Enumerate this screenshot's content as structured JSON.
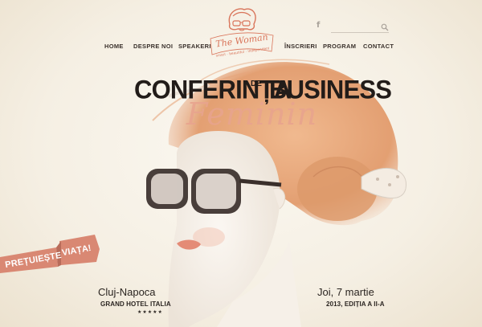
{
  "nav": {
    "left": [
      "HOME",
      "DESPRE NOI",
      "SPEAKERI"
    ],
    "right": [
      "ÎNSCRIERI",
      "PROGRAM",
      "CONTACT"
    ]
  },
  "logo": {
    "script": "The Woman",
    "tagline": "smart · beautiful · independent"
  },
  "social": {
    "facebook_glyph": "f"
  },
  "headline": {
    "line1": "CONFERINȚA",
    "small": "DE",
    "line1b": "BUSINESS",
    "line2": "Feminin"
  },
  "ribbon": {
    "part1": "PREȚUIEȘTE",
    "part2": "VIAȚA!"
  },
  "location": {
    "city": "Cluj-Napoca",
    "venue": "GRAND HOTEL ITALIA",
    "stars": "★★★★★"
  },
  "event": {
    "date": "Joi, 7 martie",
    "edition": "2013,  EDIȚIA  A II-A"
  },
  "colors": {
    "accent": "#d9745a",
    "hair": "#e8a67a",
    "ribbon": "#d98873"
  },
  "icons": [
    "facebook-icon",
    "search-icon",
    "logo-woman-icon"
  ]
}
